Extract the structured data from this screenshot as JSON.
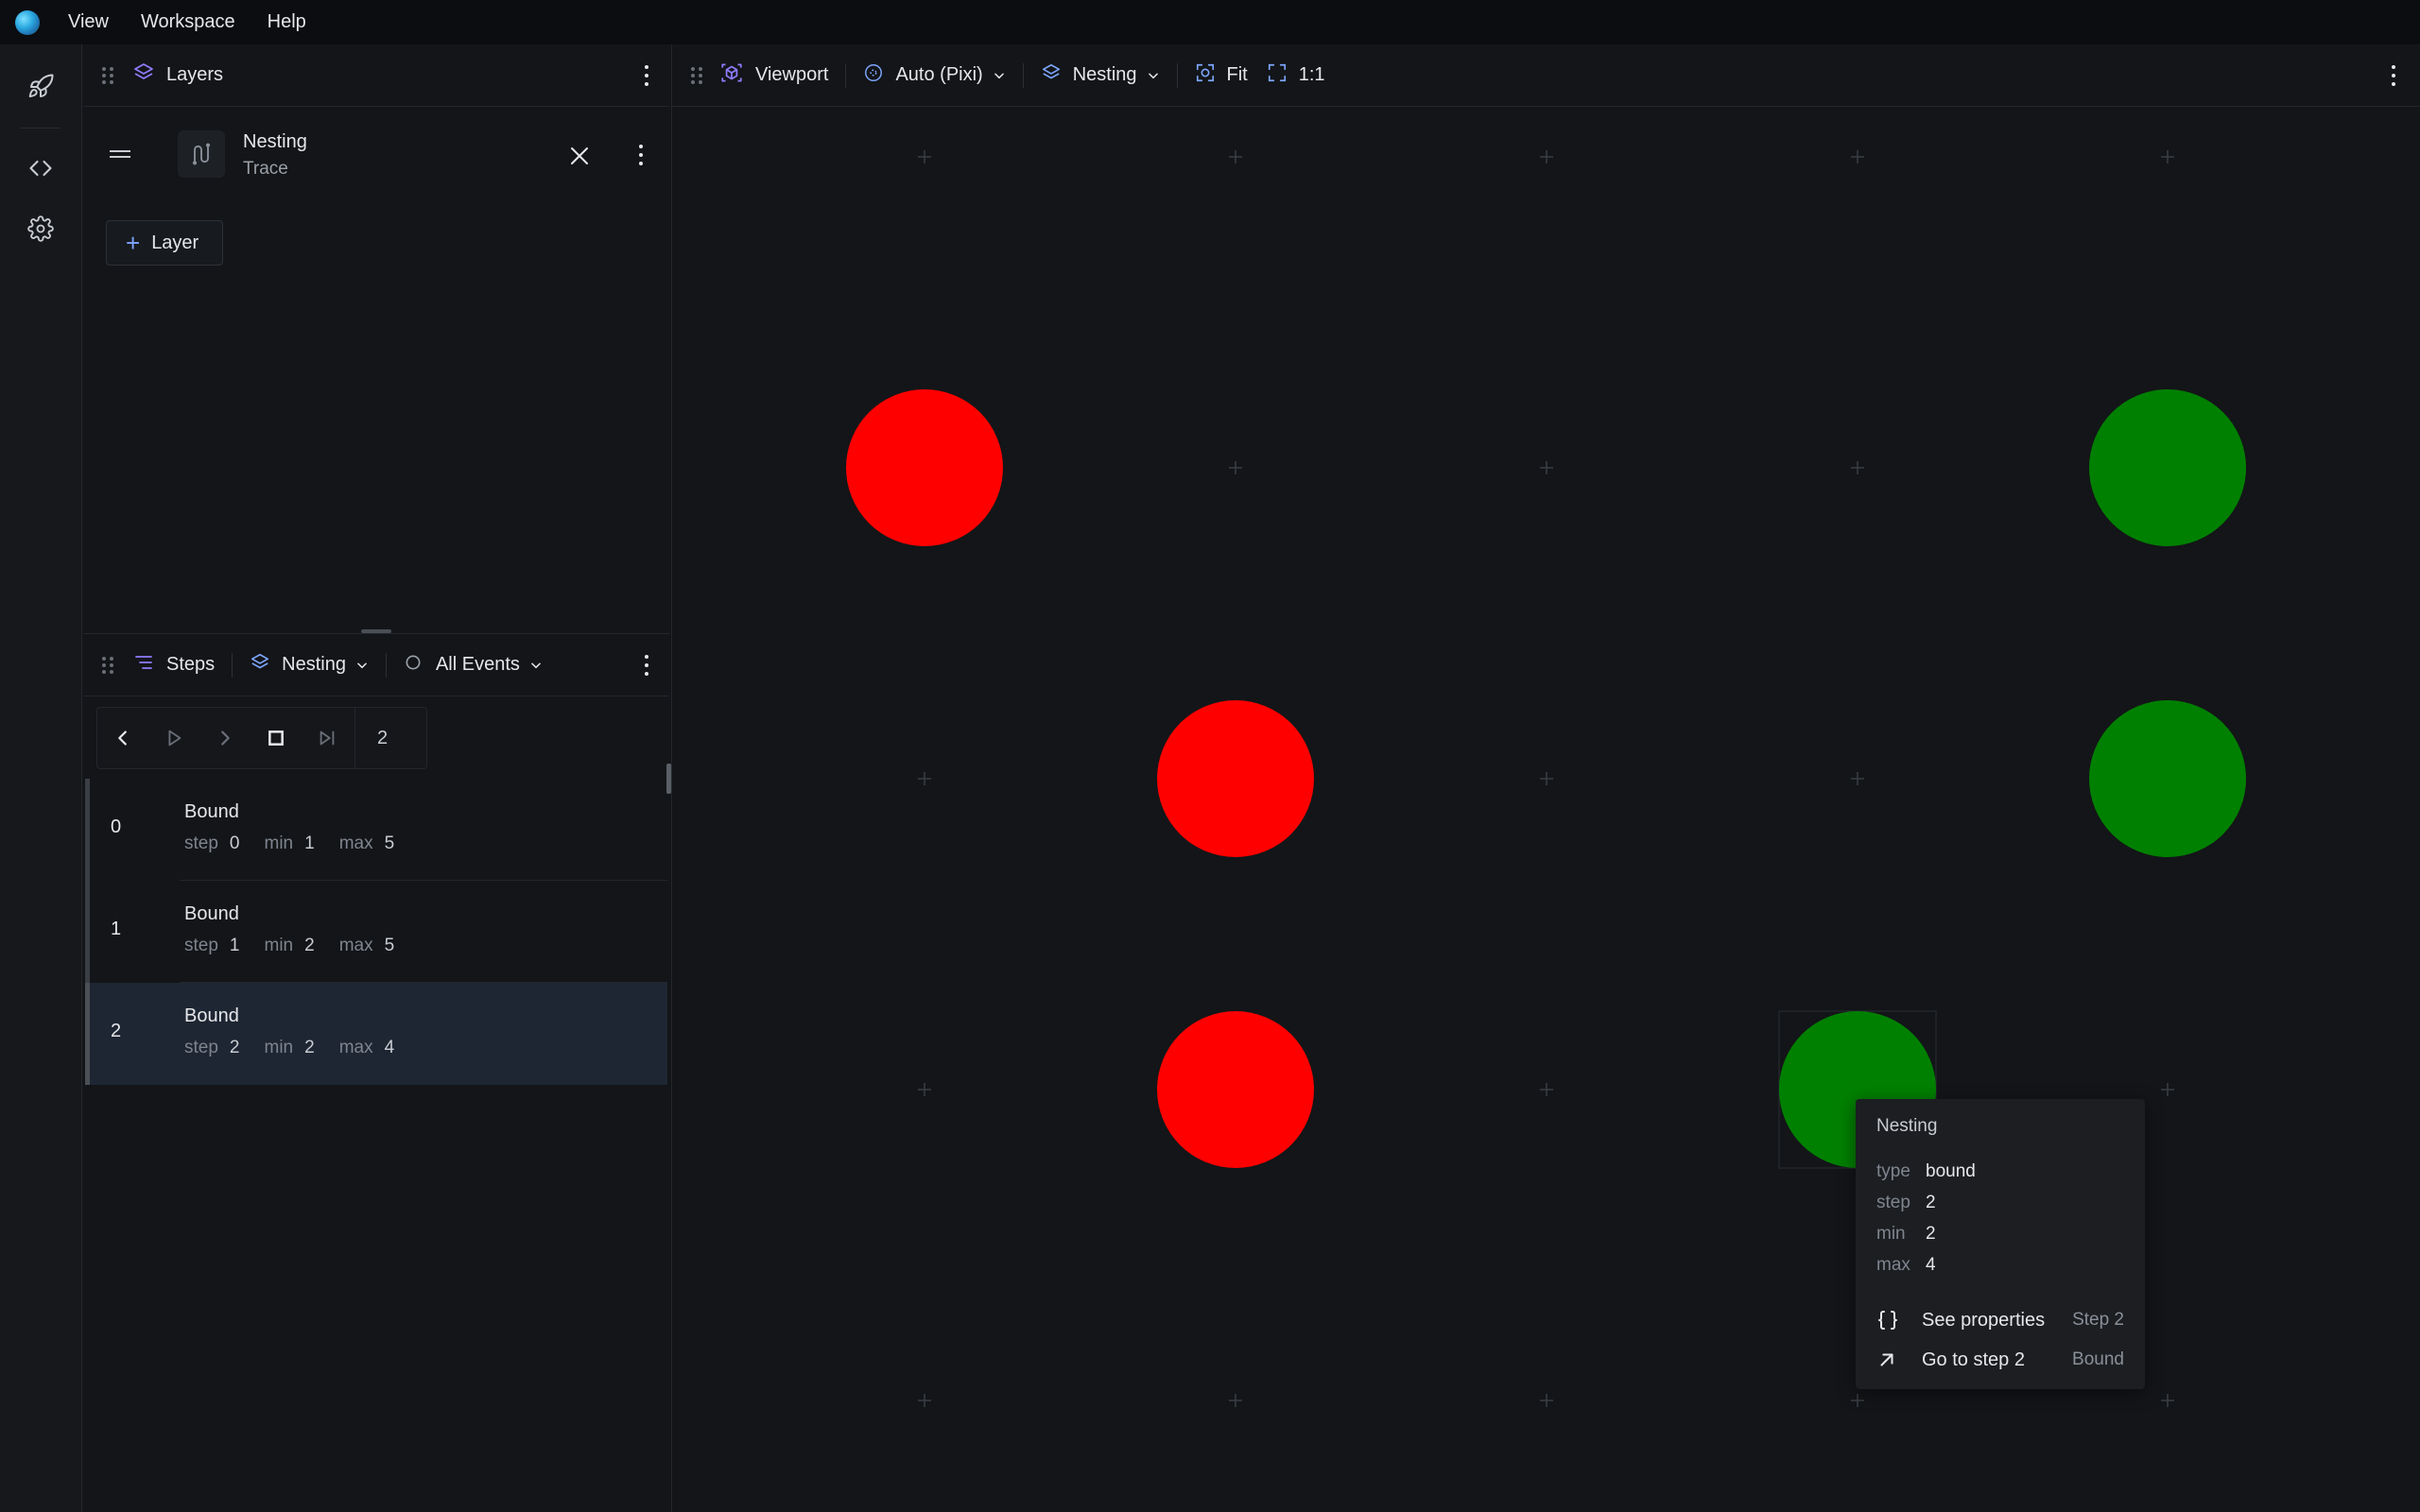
{
  "menubar": {
    "items": [
      "View",
      "Workspace",
      "Help"
    ]
  },
  "rail": {
    "icons": [
      "rocket-icon",
      "code-icon",
      "gear-icon"
    ]
  },
  "layers": {
    "title": "Layers",
    "layer": {
      "name": "Nesting",
      "subtitle": "Trace"
    },
    "add_label": "Layer"
  },
  "steps": {
    "title": "Steps",
    "layer_select": "Nesting",
    "event_filter": "All Events",
    "count": "2",
    "rows": [
      {
        "index": "0",
        "title": "Bound",
        "step_k": "step",
        "step": "0",
        "min_k": "min",
        "min": "1",
        "max_k": "max",
        "max": "5"
      },
      {
        "index": "1",
        "title": "Bound",
        "step_k": "step",
        "step": "1",
        "min_k": "min",
        "min": "2",
        "max_k": "max",
        "max": "5"
      },
      {
        "index": "2",
        "title": "Bound",
        "step_k": "step",
        "step": "2",
        "min_k": "min",
        "min": "2",
        "max_k": "max",
        "max": "4"
      }
    ],
    "selected_index": 2
  },
  "viewport": {
    "title": "Viewport",
    "renderer": "Auto (Pixi)",
    "layer": "Nesting",
    "fit_label": "Fit",
    "zoom_label": "1:1"
  },
  "colors": {
    "red_node": "#ff0000",
    "green_node": "#008000",
    "accent": "#8f7cff",
    "selected_row": "#1e2633"
  },
  "tooltip": {
    "title": "Nesting",
    "props": [
      {
        "k": "type",
        "v": "bound"
      },
      {
        "k": "step",
        "v": "2"
      },
      {
        "k": "min",
        "v": "2"
      },
      {
        "k": "max",
        "v": "4"
      }
    ],
    "actions": [
      {
        "label": "See properties",
        "hint": "Step 2",
        "icon": "braces-icon"
      },
      {
        "label": "Go to step 2",
        "hint": "Bound",
        "icon": "arrow-up-right-icon"
      }
    ]
  }
}
